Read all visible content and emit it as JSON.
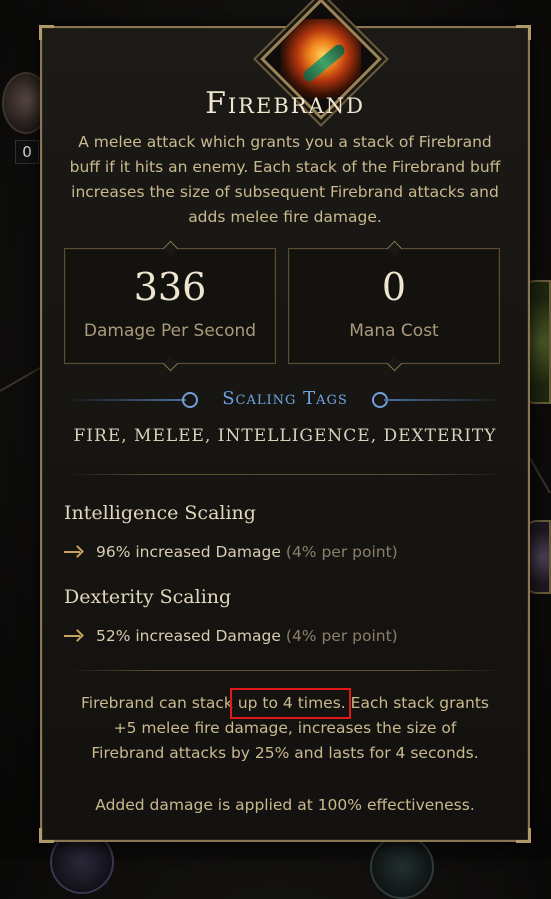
{
  "background": {
    "left_counter": "0"
  },
  "tooltip": {
    "skill_icon": "flaming-sword-icon",
    "title": "Firebrand",
    "description": "A melee attack which grants you a stack of Firebrand buff if it hits an enemy. Each stack of the Firebrand buff increases the size of subsequent Firebrand attacks and adds melee fire damage.",
    "stats": [
      {
        "value": "336",
        "label": "Damage Per Second"
      },
      {
        "value": "0",
        "label": "Mana Cost"
      }
    ],
    "scaling_tags": {
      "title": "Scaling Tags",
      "tags": "FIRE, MELEE, INTELLIGENCE, DEXTERITY"
    },
    "scaling": [
      {
        "title": "Intelligence Scaling",
        "effect": "96% increased Damage",
        "per_point": "(4% per point)"
      },
      {
        "title": "Dexterity Scaling",
        "effect": "52% increased Damage",
        "per_point": "(4% per point)"
      }
    ],
    "footer": {
      "line1_pre": "Firebrand can stack ",
      "line1_highlight": "up to 4 times.",
      "line1_post": " Each stack grants",
      "line2": "+5 melee fire damage, increases the size of",
      "line3": "Firebrand attacks by 25% and lasts for 4 seconds.",
      "note": "Added damage is applied at 100% effectiveness."
    },
    "colors": {
      "accent_gold": "#8a7650",
      "tag_blue": "#6ea5e0",
      "highlight_red": "#e01919"
    }
  }
}
